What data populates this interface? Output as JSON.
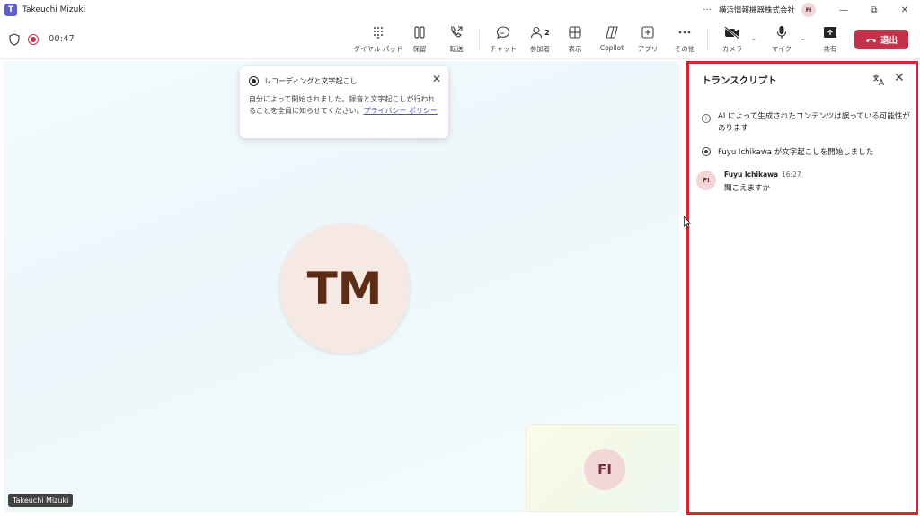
{
  "titlebar": {
    "app_icon": "teams-icon",
    "window_title": "Takeuchi Mizuki",
    "more_label": "···",
    "org_name": "横浜情報機器株式会社",
    "account_initials": "FI",
    "minimize_label": "—",
    "restore_label": "⧉",
    "close_label": "✕"
  },
  "toolbar": {
    "timer": "00:47",
    "tools": [
      {
        "label": "ダイヤル パッド",
        "icon": "dialpad-icon"
      },
      {
        "label": "保留",
        "icon": "hold-icon"
      },
      {
        "label": "転送",
        "icon": "transfer-icon"
      },
      {
        "label": "チャット",
        "icon": "chat-icon"
      },
      {
        "label": "参加者",
        "icon": "people-icon",
        "badge": "2"
      },
      {
        "label": "表示",
        "icon": "view-icon"
      },
      {
        "label": "Copilot",
        "icon": "copilot-icon"
      },
      {
        "label": "アプリ",
        "icon": "apps-icon"
      },
      {
        "label": "その他",
        "icon": "more-icon"
      },
      {
        "label": "カメラ",
        "icon": "camera-off-icon"
      },
      {
        "label": "マイク",
        "icon": "mic-icon"
      },
      {
        "label": "共有",
        "icon": "share-icon"
      }
    ],
    "leave_label": "退出",
    "colors": {
      "leave": "#c4314b",
      "recording": "#c4314b"
    }
  },
  "stage": {
    "main_participant_initials": "TM",
    "main_participant_name": "Takeuchi Mizuki",
    "self_initials": "FI"
  },
  "toast": {
    "title": "レコーディングと文字起こし",
    "body": "自分によって開始されました。録音と文字起こしが行われることを全員に知らせてください。",
    "link": "プライバシー ポリシー",
    "close_label": "✕"
  },
  "transcript": {
    "title": "トランスクリプト",
    "close_label": "✕",
    "ai_notice": "AI によって生成されたコンテンツは誤っている可能性があります",
    "started_notice": "Fuyu Ichikawa が文字起こしを開始しました",
    "entries": [
      {
        "initials": "FI",
        "speaker": "Fuyu Ichikawa",
        "time": "16:27",
        "text": "聞こえますか"
      }
    ],
    "highlight_color": "#d7252f"
  }
}
